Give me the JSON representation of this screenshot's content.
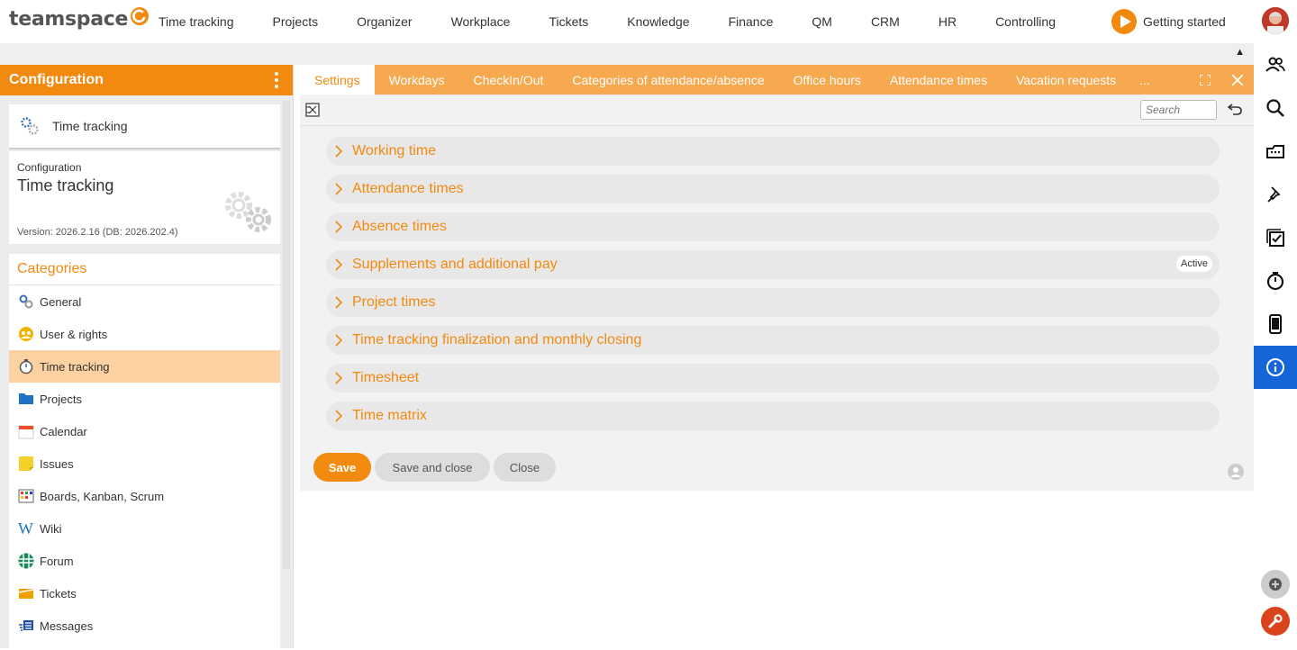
{
  "app": {
    "logo_text": "teamspace"
  },
  "topnav": [
    "Time tracking",
    "Projects",
    "Organizer",
    "Workplace",
    "Tickets",
    "Knowledge",
    "Finance",
    "QM",
    "CRM",
    "HR",
    "Controlling"
  ],
  "getting_started": "Getting started",
  "left": {
    "header_title": "Configuration",
    "module_label": "Time tracking",
    "card": {
      "small": "Configuration",
      "big": "Time tracking",
      "version": "Version: 2026.2.16 (DB: 2026.202.4)"
    },
    "categories_title": "Categories",
    "categories": [
      {
        "label": "General",
        "icon": "gear-icon"
      },
      {
        "label": "User & rights",
        "icon": "users-icon"
      },
      {
        "label": "Time tracking",
        "icon": "stopwatch-icon",
        "active": true
      },
      {
        "label": "Projects",
        "icon": "folder-icon"
      },
      {
        "label": "Calendar",
        "icon": "calendar-icon"
      },
      {
        "label": "Issues",
        "icon": "sticky-note-icon"
      },
      {
        "label": "Boards, Kanban, Scrum",
        "icon": "kanban-icon"
      },
      {
        "label": "Wiki",
        "icon": "wiki-icon"
      },
      {
        "label": "Forum",
        "icon": "forum-icon"
      },
      {
        "label": "Tickets",
        "icon": "ticket-icon"
      },
      {
        "label": "Messages",
        "icon": "messages-icon"
      }
    ]
  },
  "tabs": [
    "Settings",
    "Workdays",
    "CheckIn/Out",
    "Categories of attendance/absence",
    "Office hours",
    "Attendance times",
    "Vacation requests"
  ],
  "tab_more": "...",
  "toolbar": {
    "search_placeholder": "Search"
  },
  "sections": [
    {
      "label": "Working time"
    },
    {
      "label": "Attendance times"
    },
    {
      "label": "Absence times"
    },
    {
      "label": "Supplements and additional pay",
      "badge": "Active"
    },
    {
      "label": "Project times"
    },
    {
      "label": "Time tracking finalization and monthly closing"
    },
    {
      "label": "Timesheet"
    },
    {
      "label": "Time matrix"
    }
  ],
  "buttons": {
    "save": "Save",
    "save_close": "Save and close",
    "close": "Close"
  },
  "colors": {
    "accent": "#f28a0f",
    "tab_bar": "#f6a94f",
    "active_category": "#fdd2a2",
    "rail_active": "#1565d8"
  }
}
